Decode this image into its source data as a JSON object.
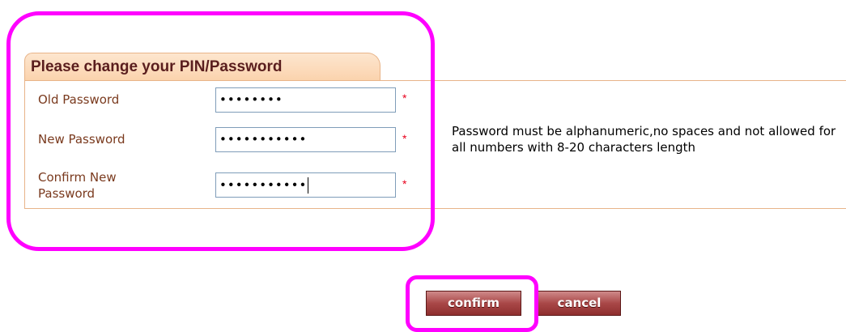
{
  "form": {
    "title": "Please change your PIN/Password",
    "fields": [
      {
        "label": "Old Password",
        "masked_value": "••••••••",
        "required_mark": "*"
      },
      {
        "label": "New Password",
        "masked_value": "•••••••••••",
        "required_mark": "*"
      },
      {
        "label": "Confirm New Password",
        "masked_value": "•••••••••••",
        "required_mark": "*"
      }
    ],
    "hint": "Password must be alphanumeric,no spaces and not allowed for all numbers with 8-20 characters length"
  },
  "buttons": {
    "confirm_label": "confirm",
    "cancel_label": "cancel"
  },
  "colors": {
    "highlight": "#ff00ff",
    "tab_background": "#fbd3ad",
    "title_text": "#5a1e1e",
    "label_text": "#7a3a1e",
    "button": "#a94848",
    "required": "#e8001c"
  }
}
